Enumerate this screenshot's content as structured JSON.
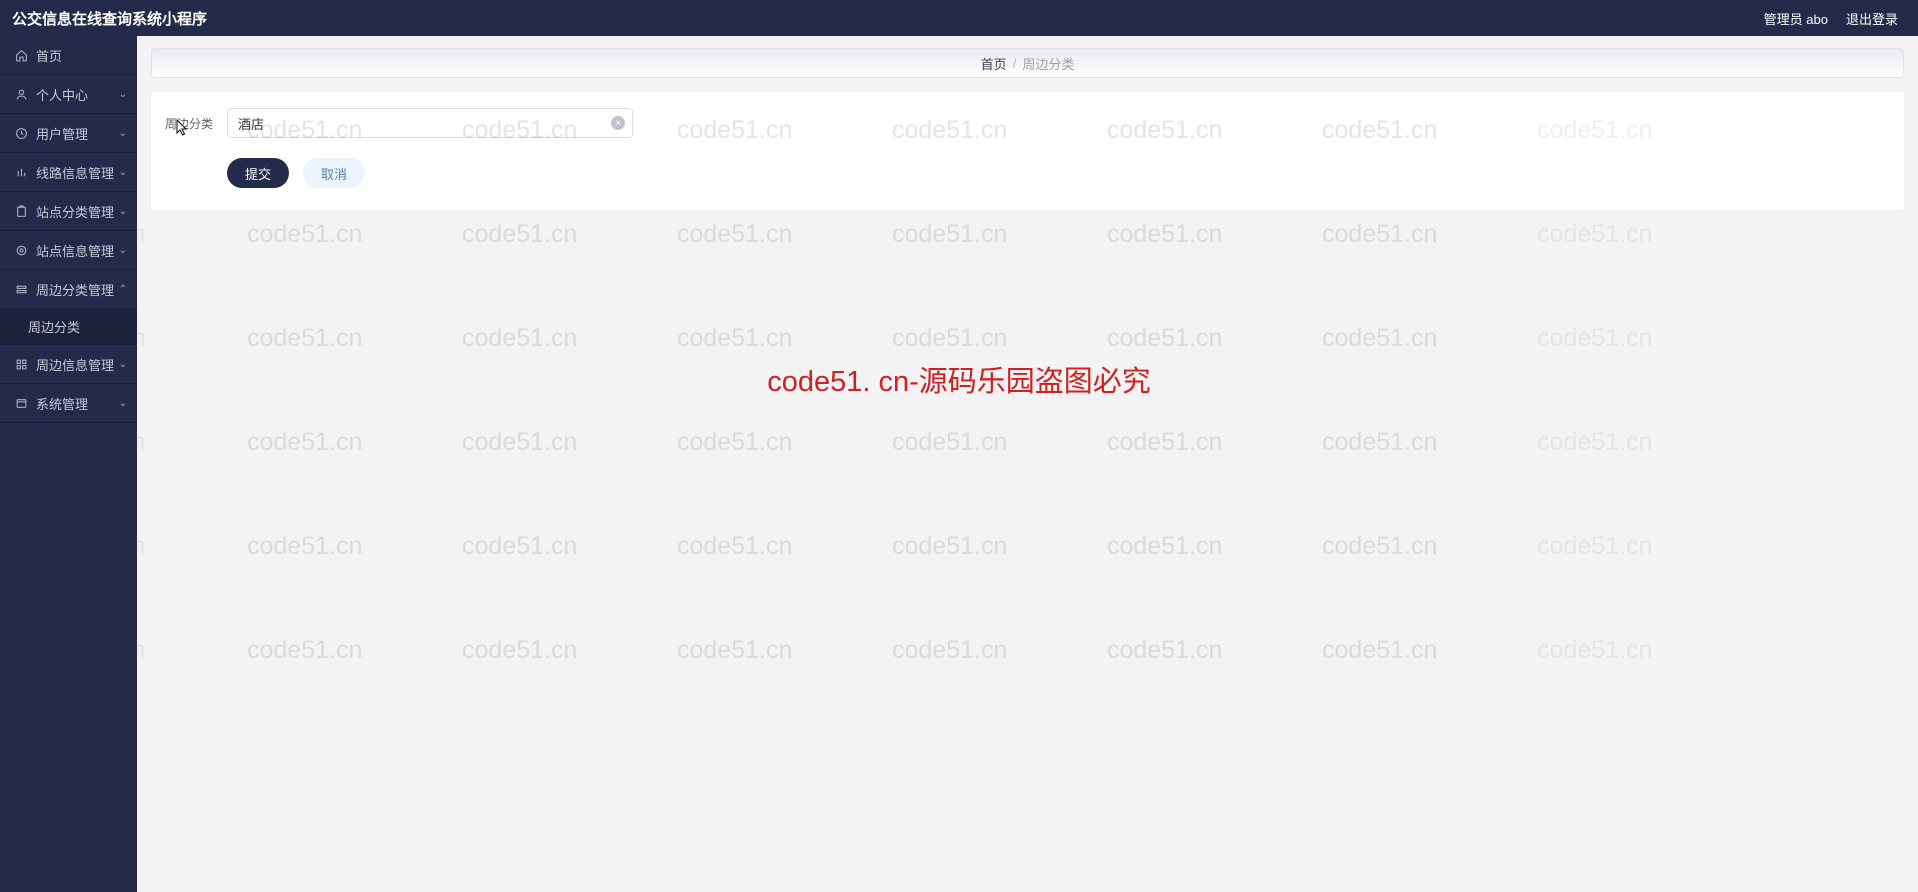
{
  "header": {
    "title": "公交信息在线查询系统小程序",
    "admin_label": "管理员 abo",
    "logout_label": "退出登录"
  },
  "sidebar": {
    "items": [
      {
        "label": "首页",
        "icon": "home-icon",
        "expandable": false
      },
      {
        "label": "个人中心",
        "icon": "user-icon",
        "expandable": true
      },
      {
        "label": "用户管理",
        "icon": "clock-icon",
        "expandable": true
      },
      {
        "label": "线路信息管理",
        "icon": "bars-icon",
        "expandable": true
      },
      {
        "label": "站点分类管理",
        "icon": "clipboard-icon",
        "expandable": true
      },
      {
        "label": "站点信息管理",
        "icon": "target-icon",
        "expandable": true
      },
      {
        "label": "周边分类管理",
        "icon": "stack-icon",
        "expandable": true,
        "expanded": true
      },
      {
        "label": "周边信息管理",
        "icon": "grid-icon",
        "expandable": true
      },
      {
        "label": "系统管理",
        "icon": "window-icon",
        "expandable": true
      }
    ],
    "sub_item_label": "周边分类"
  },
  "breadcrumb": {
    "home": "首页",
    "current": "周边分类"
  },
  "form": {
    "field_label": "周边分类",
    "field_value": "酒店",
    "submit_label": "提交",
    "cancel_label": "取消"
  },
  "watermark_text": "code51.cn",
  "center_warning": "code51. cn-源码乐园盗图必究"
}
